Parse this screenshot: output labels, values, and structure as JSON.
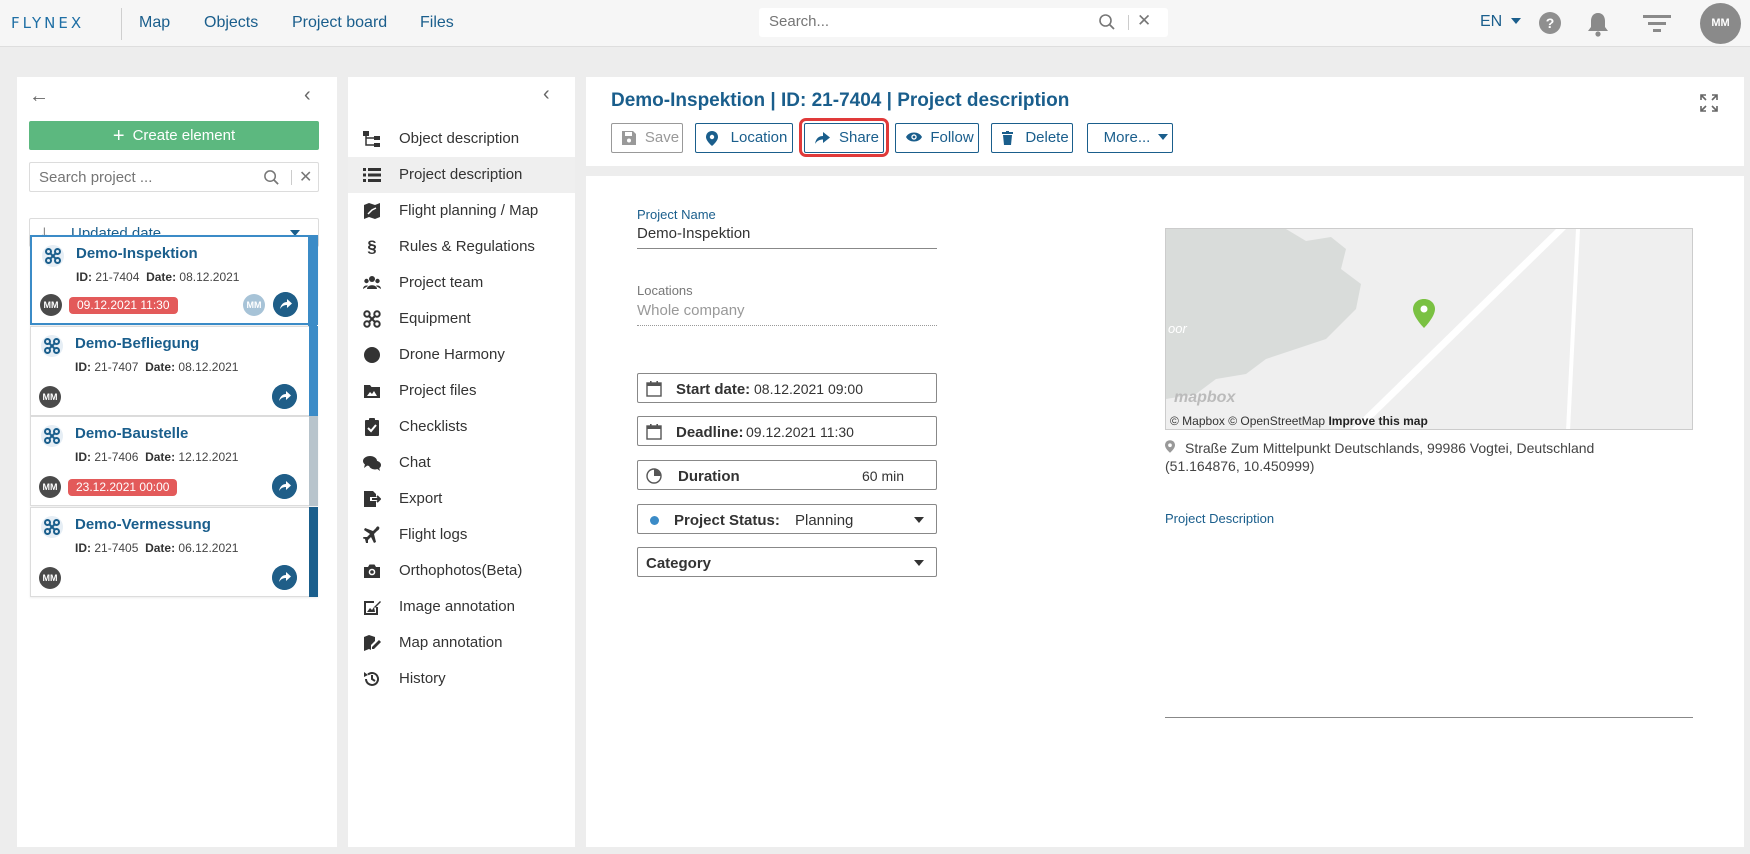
{
  "topbar": {
    "logo": "FLYNEX",
    "nav": [
      "Map",
      "Objects",
      "Project board",
      "Files"
    ],
    "search_placeholder": "Search...",
    "language": "EN",
    "help": "?",
    "user_initials": "MM"
  },
  "left_panel": {
    "create_label": "Create element",
    "search_placeholder": "Search project ...",
    "sort_label": "Updated date",
    "projects": [
      {
        "title": "Demo-Inspektion",
        "id_label": "ID:",
        "id": "21-7404",
        "date_label": "Date:",
        "date": "08.12.2021",
        "badge": "09.12.2021 11:30",
        "owner": "MM",
        "member": "MM",
        "strip": "#3b8bc7"
      },
      {
        "title": "Demo-Befliegung",
        "id_label": "ID:",
        "id": "21-7407",
        "date_label": "Date:",
        "date": "08.12.2021",
        "badge": "",
        "owner": "MM",
        "strip": "#3b8bc7"
      },
      {
        "title": "Demo-Baustelle",
        "id_label": "ID:",
        "id": "21-7406",
        "date_label": "Date:",
        "date": "12.12.2021",
        "badge": "23.12.2021 00:00",
        "owner": "MM",
        "strip": "#b8c4cc"
      },
      {
        "title": "Demo-Vermessung",
        "id_label": "ID:",
        "id": "21-7405",
        "date_label": "Date:",
        "date": "06.12.2021",
        "badge": "",
        "owner": "MM",
        "strip": "#1a5e8c"
      }
    ]
  },
  "mid_nav": {
    "items": [
      {
        "label": "Object description",
        "icon": "hierarchy-icon"
      },
      {
        "label": "Project description",
        "icon": "list-icon"
      },
      {
        "label": "Flight planning / Map",
        "icon": "map-flight-icon"
      },
      {
        "label": "Rules & Regulations",
        "icon": "paragraph-icon"
      },
      {
        "label": "Project team",
        "icon": "team-icon"
      },
      {
        "label": "Equipment",
        "icon": "drone-icon"
      },
      {
        "label": "Drone Harmony",
        "icon": "circle-icon"
      },
      {
        "label": "Project files",
        "icon": "folder-image-icon"
      },
      {
        "label": "Checklists",
        "icon": "clipboard-check-icon"
      },
      {
        "label": "Chat",
        "icon": "chat-icon"
      },
      {
        "label": "Export",
        "icon": "export-icon"
      },
      {
        "label": "Flight logs",
        "icon": "plane-icon"
      },
      {
        "label": "Orthophotos(Beta)",
        "icon": "camera-icon"
      },
      {
        "label": "Image annotation",
        "icon": "image-edit-icon"
      },
      {
        "label": "Map annotation",
        "icon": "map-edit-icon"
      },
      {
        "label": "History",
        "icon": "history-icon"
      }
    ]
  },
  "main": {
    "title": "Demo-Inspektion | ID: 21-7404 | Project description",
    "toolbar": {
      "save": "Save",
      "location": "Location",
      "share": "Share",
      "follow": "Follow",
      "delete": "Delete",
      "more": "More..."
    },
    "project_name_label": "Project Name",
    "project_name": "Demo-Inspektion",
    "locations_label": "Locations",
    "locations_value": "Whole company",
    "start_date_label": "Start date:",
    "start_date": "08.12.2021 09:00",
    "deadline_label": "Deadline:",
    "deadline": "09.12.2021 11:30",
    "duration_label": "Duration",
    "duration": "60 min",
    "status_label": "Project Status:",
    "status": "Planning",
    "category_label": "Category",
    "map": {
      "logo": "mapbox",
      "attribution": "© Mapbox © OpenStreetMap",
      "improve": "Improve this map",
      "fragment": "oor"
    },
    "address": "Straße Zum Mittelpunkt Deutschlands, 99986 Vogtei, Deutschland",
    "coords": "(51.164876, 10.450999)",
    "description_label": "Project Description"
  },
  "colors": {
    "primary": "#1a5e8c",
    "create": "#5cb87f",
    "badge": "#e35a5a",
    "highlight": "#e03a3a",
    "pin": "#7ac142"
  }
}
